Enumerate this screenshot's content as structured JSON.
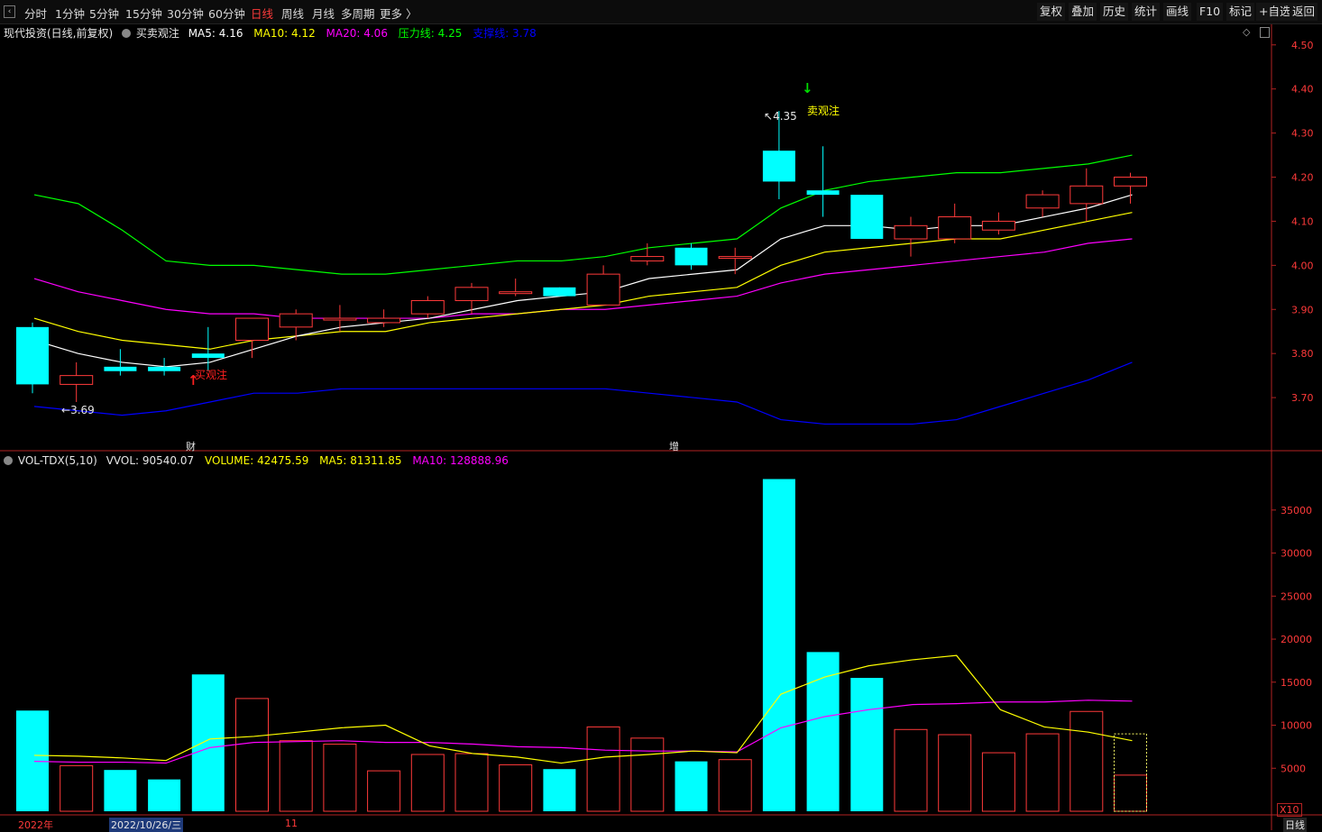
{
  "toolbar": {
    "left_items": [
      "分时",
      "1分钟",
      "5分钟",
      "15分钟",
      "30分钟",
      "60分钟",
      "日线",
      "周线",
      "月线",
      "多周期",
      "更多 〉"
    ],
    "active_index": 6,
    "right_items": [
      "复权",
      "叠加",
      "历史",
      "统计",
      "画线",
      "F10",
      "标记",
      "+自选",
      "返回"
    ],
    "active_color": "#ff3b3b"
  },
  "main_legend": {
    "stock_name": "现代投资(日线,前复权)",
    "indicator": "买卖观注",
    "ma5": "MA5: 4.16",
    "ma10": "MA10: 4.12",
    "ma20": "MA20: 4.06",
    "pressure": "压力线: 4.25",
    "support": "支撑线: 3.78"
  },
  "vol_legend": {
    "name": "VOL-TDX(5,10)",
    "vvol": "VVOL: 90540.07",
    "volume": "VOLUME: 42475.59",
    "ma5": "MA5: 81311.85",
    "ma10": "MA10: 128888.96"
  },
  "annotations": {
    "low_label": "3.69",
    "high_label": "4.35",
    "buy_text": "买观注",
    "sell_text": "卖观注",
    "marker_cai": "财",
    "marker_zeng": "增"
  },
  "bottom": {
    "year": "2022年",
    "date": "2022/10/26/三",
    "month": "11",
    "unit": "X10",
    "period_tab": "日线"
  },
  "colors": {
    "up": "#ff3a3a",
    "down": "#00ffff",
    "ma5": "#ffffff",
    "ma10": "#ffff00",
    "ma20": "#ff00ff",
    "pressure": "#00ff00",
    "support": "#0000ff",
    "axis": "#b22222"
  },
  "chart_data": [
    {
      "type": "candlestick",
      "y_ticks": [
        3.7,
        3.8,
        3.9,
        4.0,
        4.1,
        4.2,
        4.3,
        4.4,
        4.5
      ],
      "y_tick_labels": [
        "3.70",
        "3.80",
        "3.90",
        "4.00",
        "4.10",
        "4.20",
        "4.30",
        "4.40",
        "4.50"
      ],
      "ylim": [
        3.6,
        4.52
      ],
      "candles": [
        {
          "o": 3.86,
          "c": 3.73,
          "h": 3.87,
          "l": 3.71
        },
        {
          "o": 3.73,
          "c": 3.75,
          "h": 3.78,
          "l": 3.69
        },
        {
          "o": 3.77,
          "c": 3.76,
          "h": 3.81,
          "l": 3.75
        },
        {
          "o": 3.77,
          "c": 3.76,
          "h": 3.79,
          "l": 3.75
        },
        {
          "o": 3.8,
          "c": 3.79,
          "h": 3.86,
          "l": 3.76
        },
        {
          "o": 3.83,
          "c": 3.88,
          "h": 3.88,
          "l": 3.79
        },
        {
          "o": 3.86,
          "c": 3.89,
          "h": 3.9,
          "l": 3.83
        },
        {
          "o": 3.88,
          "c": 3.88,
          "h": 3.91,
          "l": 3.85
        },
        {
          "o": 3.87,
          "c": 3.88,
          "h": 3.9,
          "l": 3.86
        },
        {
          "o": 3.89,
          "c": 3.92,
          "h": 3.93,
          "l": 3.88
        },
        {
          "o": 3.92,
          "c": 3.95,
          "h": 3.96,
          "l": 3.89
        },
        {
          "o": 3.94,
          "c": 3.94,
          "h": 3.97,
          "l": 3.93
        },
        {
          "o": 3.95,
          "c": 3.93,
          "h": 3.95,
          "l": 3.93
        },
        {
          "o": 3.91,
          "c": 3.98,
          "h": 4.0,
          "l": 3.91
        },
        {
          "o": 4.01,
          "c": 4.02,
          "h": 4.05,
          "l": 4.0
        },
        {
          "o": 4.04,
          "c": 4.0,
          "h": 4.05,
          "l": 3.99
        },
        {
          "o": 4.02,
          "c": 4.02,
          "h": 4.04,
          "l": 3.98
        },
        {
          "o": 4.26,
          "c": 4.19,
          "h": 4.35,
          "l": 4.15
        },
        {
          "o": 4.17,
          "c": 4.16,
          "h": 4.27,
          "l": 4.11
        },
        {
          "o": 4.16,
          "c": 4.06,
          "h": 4.16,
          "l": 4.06
        },
        {
          "o": 4.06,
          "c": 4.09,
          "h": 4.11,
          "l": 4.02
        },
        {
          "o": 4.06,
          "c": 4.11,
          "h": 4.14,
          "l": 4.05
        },
        {
          "o": 4.08,
          "c": 4.1,
          "h": 4.12,
          "l": 4.07
        },
        {
          "o": 4.13,
          "c": 4.16,
          "h": 4.17,
          "l": 4.11
        },
        {
          "o": 4.14,
          "c": 4.18,
          "h": 4.22,
          "l": 4.1
        },
        {
          "o": 4.18,
          "c": 4.2,
          "h": 4.21,
          "l": 4.14
        }
      ],
      "ma5": [
        3.83,
        3.8,
        3.78,
        3.77,
        3.78,
        3.81,
        3.84,
        3.86,
        3.87,
        3.88,
        3.9,
        3.92,
        3.93,
        3.94,
        3.97,
        3.98,
        3.99,
        4.06,
        4.09,
        4.09,
        4.08,
        4.09,
        4.09,
        4.11,
        4.13,
        4.16
      ],
      "ma10": [
        3.88,
        3.85,
        3.83,
        3.82,
        3.81,
        3.83,
        3.84,
        3.85,
        3.85,
        3.87,
        3.88,
        3.89,
        3.9,
        3.91,
        3.93,
        3.94,
        3.95,
        4.0,
        4.03,
        4.04,
        4.05,
        4.06,
        4.06,
        4.08,
        4.1,
        4.12
      ],
      "ma20": [
        3.97,
        3.94,
        3.92,
        3.9,
        3.89,
        3.89,
        3.88,
        3.88,
        3.88,
        3.88,
        3.89,
        3.89,
        3.9,
        3.9,
        3.91,
        3.92,
        3.93,
        3.96,
        3.98,
        3.99,
        4.0,
        4.01,
        4.02,
        4.03,
        4.05,
        4.06
      ],
      "pressure": [
        4.16,
        4.14,
        4.08,
        4.01,
        4.0,
        4.0,
        3.99,
        3.98,
        3.98,
        3.99,
        4.0,
        4.01,
        4.01,
        4.02,
        4.04,
        4.05,
        4.06,
        4.13,
        4.17,
        4.19,
        4.2,
        4.21,
        4.21,
        4.22,
        4.23,
        4.25
      ],
      "support": [
        3.68,
        3.67,
        3.66,
        3.67,
        3.69,
        3.71,
        3.71,
        3.72,
        3.72,
        3.72,
        3.72,
        3.72,
        3.72,
        3.72,
        3.71,
        3.7,
        3.69,
        3.65,
        3.64,
        3.64,
        3.64,
        3.65,
        3.68,
        3.71,
        3.74,
        3.78
      ]
    },
    {
      "type": "bar",
      "y_ticks": [
        5000,
        10000,
        15000,
        20000,
        25000,
        30000,
        35000
      ],
      "y_tick_labels": [
        "5000",
        "10000",
        "15000",
        "20000",
        "25000",
        "30000",
        "35000"
      ],
      "ylim": [
        0,
        39800
      ],
      "values": [
        11700,
        5300,
        4800,
        3700,
        15900,
        13100,
        8200,
        7800,
        4700,
        6600,
        6700,
        5400,
        4900,
        9800,
        8500,
        5800,
        6000,
        38600,
        18500,
        15500,
        9500,
        8900,
        6800,
        9000,
        11600,
        4200
      ],
      "ma5": [
        6500,
        6500,
        6400,
        6200,
        6100,
        8300,
        8600,
        9100,
        9700,
        9900,
        9900,
        7700,
        6700,
        6300,
        5600,
        6300,
        6600,
        7000,
        6800,
        13600,
        15600,
        16800,
        17600,
        18100,
        11800,
        9800,
        9200,
        8200
      ],
      "ma10": [
        5800,
        5700,
        5700,
        5700,
        5600,
        7400,
        8000,
        8100,
        8200,
        8000,
        8000,
        8000,
        7800,
        7500,
        7400,
        7100,
        7000,
        7000,
        6900,
        9700,
        11000,
        11800,
        12400,
        12500,
        12700,
        12700,
        12900,
        12800
      ],
      "volume_ma5": [
        6500,
        6400,
        6200,
        5900,
        8400,
        8700,
        9200,
        9700,
        10000,
        7600,
        6700,
        6300,
        5600,
        6300,
        6600,
        7000,
        6800,
        13600,
        15600,
        16900,
        17600,
        18100,
        11800,
        9800,
        9200,
        8200
      ],
      "volume_ma10": [
        5800,
        5700,
        5700,
        5600,
        7400,
        8000,
        8100,
        8200,
        8000,
        8000,
        7800,
        7500,
        7400,
        7100,
        7000,
        7000,
        6900,
        9700,
        11000,
        11800,
        12400,
        12500,
        12700,
        12700,
        12900,
        12800
      ]
    }
  ]
}
